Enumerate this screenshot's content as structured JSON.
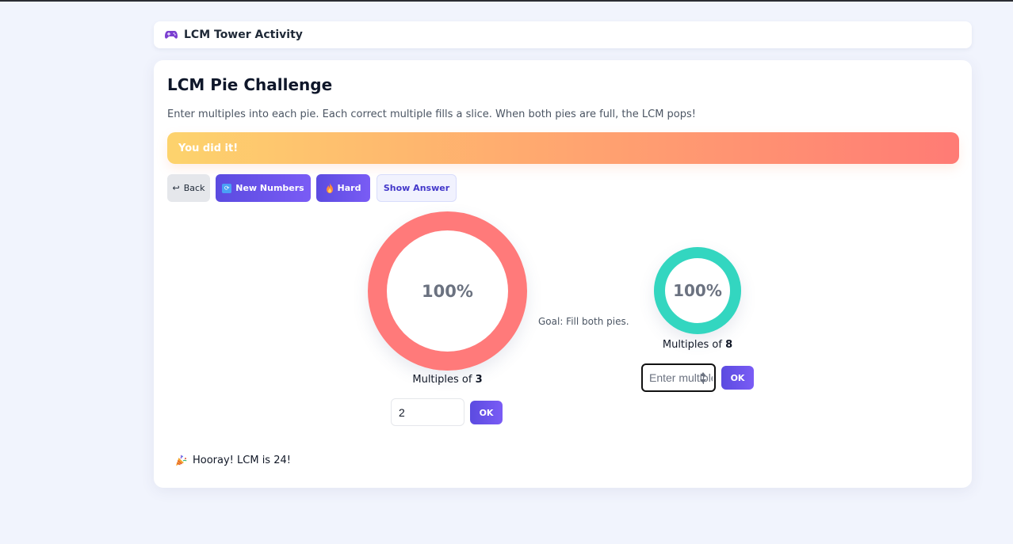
{
  "app": {
    "title": "LCM Tower Activity",
    "icon": "gamepad-icon"
  },
  "game": {
    "heading": "LCM Pie Challenge",
    "instructions": "Enter multiples into each pie. Each correct multiple fills a slice. When both pies are full, the LCM pops!",
    "banner": "You did it!",
    "goal": "Goal: Fill both pies.",
    "result": "Hooray! LCM is 24!"
  },
  "toolbar": {
    "back": "Back",
    "new_numbers": "New Numbers",
    "difficulty": "Hard",
    "show_answer": "Show Answer"
  },
  "pies": [
    {
      "number": "3",
      "label_prefix": "Multiples of ",
      "fill_text": "100%",
      "fill_fraction": 1.0,
      "color": "#ff7a7a",
      "input_value": "2",
      "input_placeholder": "Enter multiple",
      "button": "OK"
    },
    {
      "number": "8",
      "label_prefix": "Multiples of ",
      "fill_text": "100%",
      "fill_fraction": 1.0,
      "color": "#33d6c0",
      "input_value": "",
      "input_placeholder": "Enter multiple",
      "button": "OK"
    }
  ],
  "colors": {
    "accent": "#6a52ec",
    "background": "#f1f4fd",
    "banner_start": "#fdd36d",
    "banner_end": "#ff7b75"
  }
}
